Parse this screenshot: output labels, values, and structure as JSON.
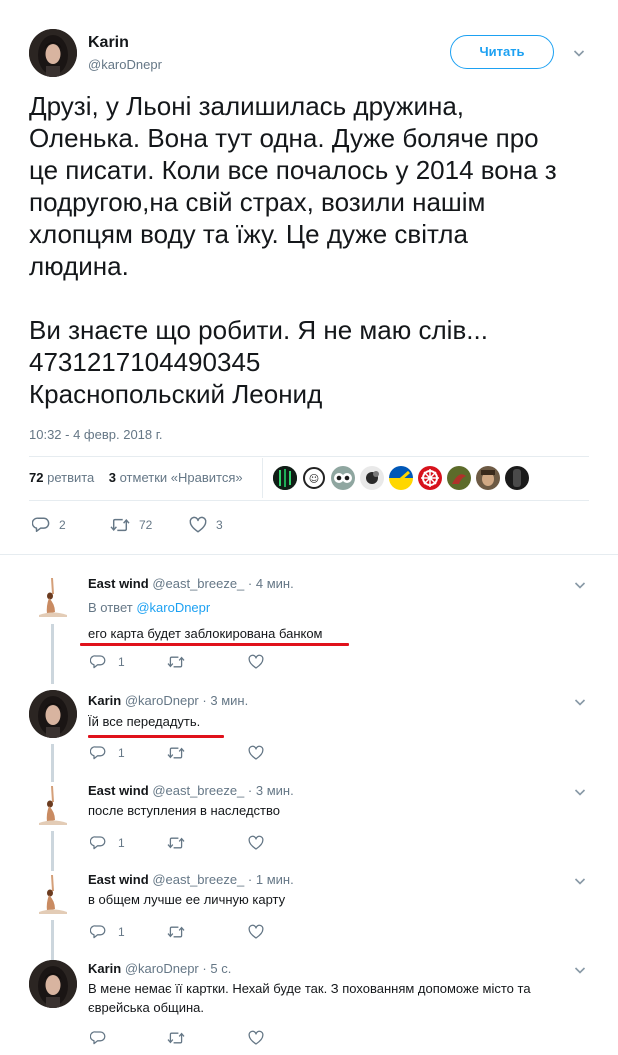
{
  "main_tweet": {
    "author_name": "Karin",
    "author_handle": "@karoDnepr",
    "follow_label": "Читать",
    "text_lines": [
      "Друзі, у Льоні залишилась дружина,",
      "Оленька. Вона тут одна. Дуже боляче про",
      "це писати. Коли все почалось у 2014 вона з",
      "подругою,на свій страх, возили нашім",
      "хлопцям воду та їжу. Це дуже світла",
      "людина."
    ],
    "text_lines_2": [
      "Ви знаєте що робити. Я не маю слів...",
      "4731217104490345",
      "Краснопольский Леонид"
    ],
    "timestamp": "10:32 - 4 февр. 2018 г.",
    "retweets_count": "72",
    "retweets_label": "ретвита",
    "likes_count": "3",
    "likes_label": "отметки «Нравится»",
    "actions": {
      "reply": "2",
      "retweet": "72",
      "like": "3"
    }
  },
  "replies": [
    {
      "name": "East wind",
      "handle": "@east_breeze_",
      "time": "4 мин.",
      "in_reply_prefix": "В ответ",
      "in_reply_to": "@karoDnepr",
      "text": "его карта будет заблокирована банком",
      "reply_count": "1",
      "avatar": "yoga"
    },
    {
      "name": "Karin",
      "handle": "@karoDnepr",
      "time": "3 мин.",
      "text": "Їй все передадуть.",
      "reply_count": "1",
      "avatar": "woman"
    },
    {
      "name": "East wind",
      "handle": "@east_breeze_",
      "time": "3 мин.",
      "text": "после вступления в наследство",
      "reply_count": "1",
      "avatar": "yoga"
    },
    {
      "name": "East wind",
      "handle": "@east_breeze_",
      "time": "1 мин.",
      "text": "в общем лучше ее личную карту",
      "reply_count": "1",
      "avatar": "yoga"
    },
    {
      "name": "Karin",
      "handle": "@karoDnepr",
      "time": "5 с.",
      "text_line1": "В мене немає її картки. Нехай буде так. З похованням допоможе місто та",
      "text_line2": "єврейська община.",
      "avatar": "woman"
    }
  ],
  "colors": {
    "accent": "#1da1f2",
    "text": "#14171a",
    "muted": "#657786",
    "divider": "#e6ecf0",
    "thread_line": "#ccd6dd",
    "annotation_red": "#e0111b"
  },
  "icons": [
    "chevron-down-icon",
    "reply-icon",
    "retweet-icon",
    "heart-icon"
  ]
}
